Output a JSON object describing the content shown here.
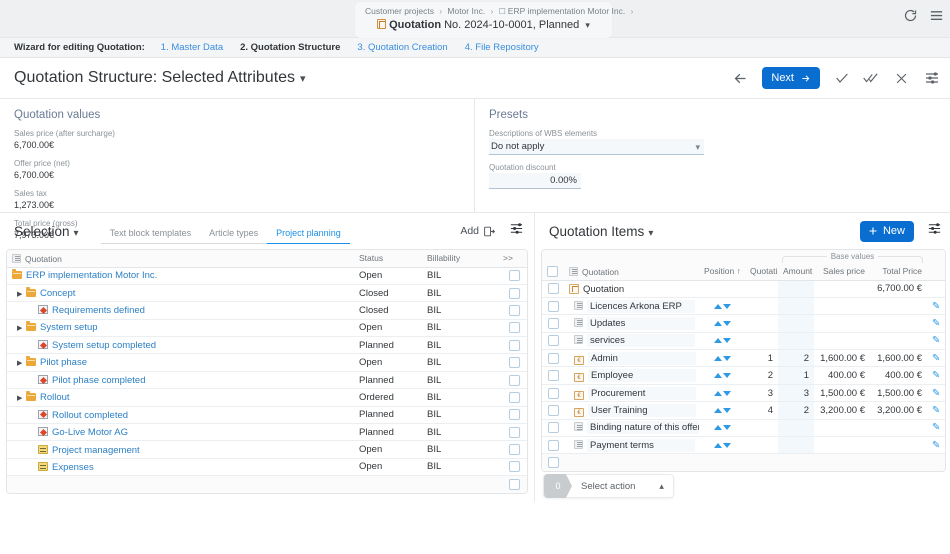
{
  "shellbar": {
    "breadcrumb": [
      "Customer projects",
      "Motor Inc.",
      "ERP implementation Motor Inc."
    ],
    "object_type": "Quotation",
    "object_detail": "No. 2024-10-0001, Planned",
    "refresh_icon": "refresh-icon",
    "menu_icon": "hamburger-menu-icon"
  },
  "wizard": {
    "label": "Wizard for editing Quotation:",
    "steps": [
      {
        "label": "1. Master Data",
        "current": false
      },
      {
        "label": "2. Quotation Structure",
        "current": true
      },
      {
        "label": "3. Quotation Creation",
        "current": false
      },
      {
        "label": "4. File Repository",
        "current": false
      }
    ]
  },
  "page": {
    "title": "Quotation Structure: Selected Attributes",
    "toolbar": {
      "back_icon": "arrow-left-icon",
      "next_label": "Next",
      "accept_icon": "check-icon",
      "accept_all_icon": "double-check-icon",
      "close_icon": "close-x-icon",
      "settings_icon": "settings-sliders-icon"
    }
  },
  "quotation_values": {
    "title": "Quotation values",
    "fields": [
      {
        "label": "Sales price (after surcharge)",
        "value": "6,700.00€"
      },
      {
        "label": "Offer price (net)",
        "value": "6,700.00€"
      },
      {
        "label": "Sales tax",
        "value": "1,273.00€"
      },
      {
        "label": "Total price (gross)",
        "value": "7,973.00€"
      }
    ]
  },
  "presets": {
    "title": "Presets",
    "wbs_label": "Descriptions of WBS elements",
    "wbs_value": "Do not apply",
    "discount_label": "Quotation discount",
    "discount_value": "0.00%"
  },
  "selection": {
    "title": "Selection",
    "tabs": [
      {
        "label": "Text block templates",
        "active": false
      },
      {
        "label": "Article types",
        "active": false
      },
      {
        "label": "Project planning",
        "active": true
      }
    ],
    "add_label": "Add",
    "add_icon": "add-to-list-icon",
    "settings_icon": "settings-sliders-icon",
    "columns": [
      "Quotation",
      "Status",
      "Billability",
      ">>"
    ],
    "rows": [
      {
        "name": "ERP implementation Motor Inc.",
        "status": "Open",
        "billability": "BIL",
        "indent": 0,
        "icon": "folder-icon",
        "expander": false,
        "link": true
      },
      {
        "name": "Concept",
        "status": "Closed",
        "billability": "BIL",
        "indent": 1,
        "icon": "folder-icon",
        "expander": true,
        "link": true
      },
      {
        "name": "Requirements defined",
        "status": "Closed",
        "billability": "BIL",
        "indent": 2,
        "icon": "milestone-icon",
        "expander": false,
        "link": true
      },
      {
        "name": "System setup",
        "status": "Open",
        "billability": "BIL",
        "indent": 1,
        "icon": "folder-icon",
        "expander": true,
        "link": true
      },
      {
        "name": "System setup completed",
        "status": "Planned",
        "billability": "BIL",
        "indent": 2,
        "icon": "milestone-icon",
        "expander": false,
        "link": true
      },
      {
        "name": "Pilot phase",
        "status": "Open",
        "billability": "BIL",
        "indent": 1,
        "icon": "folder-icon",
        "expander": true,
        "link": true
      },
      {
        "name": "Pilot phase completed",
        "status": "Planned",
        "billability": "BIL",
        "indent": 2,
        "icon": "milestone-icon",
        "expander": false,
        "link": true
      },
      {
        "name": "Rollout",
        "status": "Ordered",
        "billability": "BIL",
        "indent": 1,
        "icon": "folder-icon",
        "expander": true,
        "link": true
      },
      {
        "name": "Rollout completed",
        "status": "Planned",
        "billability": "BIL",
        "indent": 2,
        "icon": "milestone-icon",
        "expander": false,
        "link": true
      },
      {
        "name": "Go-Live Motor AG",
        "status": "Planned",
        "billability": "BIL",
        "indent": 2,
        "icon": "milestone-icon",
        "expander": false,
        "link": true
      },
      {
        "name": "Project management",
        "status": "Open",
        "billability": "BIL",
        "indent": 2,
        "icon": "task-icon",
        "expander": false,
        "link": true
      },
      {
        "name": "Expenses",
        "status": "Open",
        "billability": "BIL",
        "indent": 2,
        "icon": "task-icon",
        "expander": false,
        "link": true
      }
    ]
  },
  "quotation_items": {
    "title": "Quotation Items",
    "new_label": "New",
    "new_icon": "plus-icon",
    "settings_icon": "settings-sliders-icon",
    "group_header": "Base values",
    "columns": [
      "Quotation",
      "Position ↑",
      "Quotati",
      "Amount",
      "Sales price",
      "Total Price"
    ],
    "rows": [
      {
        "name": "Quotation",
        "icon": "quotation-icon",
        "indent": 0,
        "sorter": false,
        "position": "",
        "quotation": "",
        "amount": "",
        "sales_price": "",
        "total_price": "6,700.00 €",
        "edit": false
      },
      {
        "name": "Licences Arkona ERP",
        "icon": "text-block-icon",
        "indent": 1,
        "sorter": true,
        "position": "",
        "quotation": "",
        "amount": "",
        "sales_price": "",
        "total_price": "",
        "edit": true
      },
      {
        "name": "Updates",
        "icon": "text-block-icon",
        "indent": 1,
        "sorter": true,
        "position": "",
        "quotation": "",
        "amount": "",
        "sales_price": "",
        "total_price": "",
        "edit": true
      },
      {
        "name": "services",
        "icon": "text-block-icon",
        "indent": 1,
        "sorter": true,
        "position": "",
        "quotation": "",
        "amount": "",
        "sales_price": "",
        "total_price": "",
        "edit": true
      },
      {
        "name": "Admin",
        "icon": "article-icon",
        "indent": 1,
        "sorter": true,
        "position": "1",
        "quotation": "",
        "amount": "2",
        "sales_price": "1,600.00 €",
        "total_price": "1,600.00 €",
        "edit": true
      },
      {
        "name": "Employee",
        "icon": "article-icon",
        "indent": 1,
        "sorter": true,
        "position": "2",
        "quotation": "",
        "amount": "1",
        "sales_price": "400.00 €",
        "total_price": "400.00 €",
        "edit": true
      },
      {
        "name": "Procurement",
        "icon": "article-icon",
        "indent": 1,
        "sorter": true,
        "position": "3",
        "quotation": "",
        "amount": "3",
        "sales_price": "1,500.00 €",
        "total_price": "1,500.00 €",
        "edit": true
      },
      {
        "name": "User Training",
        "icon": "article-icon",
        "indent": 1,
        "sorter": true,
        "position": "4",
        "quotation": "",
        "amount": "2",
        "sales_price": "3,200.00 €",
        "total_price": "3,200.00 €",
        "edit": true
      },
      {
        "name": "Binding nature of this offer",
        "icon": "text-block-icon",
        "indent": 1,
        "sorter": true,
        "position": "",
        "quotation": "",
        "amount": "",
        "sales_price": "",
        "total_price": "",
        "edit": true
      },
      {
        "name": "Payment terms",
        "icon": "text-block-icon",
        "indent": 1,
        "sorter": true,
        "position": "",
        "quotation": "",
        "amount": "",
        "sales_price": "",
        "total_price": "",
        "edit": true
      }
    ]
  },
  "action_bar": {
    "count": "0",
    "label": "Select action",
    "chevron_icon": "chevron-up-icon"
  }
}
